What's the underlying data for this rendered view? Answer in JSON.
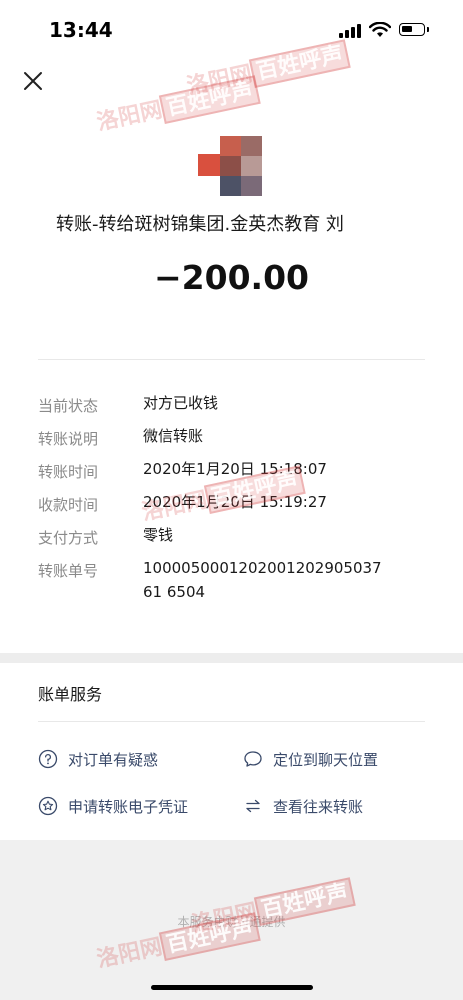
{
  "status_bar": {
    "time": "13:44"
  },
  "header": {
    "close_icon": "close-icon"
  },
  "payment": {
    "payee": "转账-转给斑树锦集团.金英杰教育 刘",
    "amount": "−200.00"
  },
  "details": [
    {
      "label": "当前状态",
      "value": "对方已收钱"
    },
    {
      "label": "转账说明",
      "value": "微信转账"
    },
    {
      "label": "转账时间",
      "value": "2020年1月20日 15:18:07"
    },
    {
      "label": "收款时间",
      "value": "2020年1月20日 15:19:27"
    },
    {
      "label": "支付方式",
      "value": "零钱"
    },
    {
      "label": "转账单号",
      "value": "100005000120200120290503761 6504"
    }
  ],
  "services": {
    "title": "账单服务",
    "items": [
      {
        "label": "对订单有疑惑",
        "icon": "question-icon"
      },
      {
        "label": "定位到聊天位置",
        "icon": "chat-bubble-icon"
      },
      {
        "label": "申请转账电子凭证",
        "icon": "star-badge-icon"
      },
      {
        "label": "查看往来转账",
        "icon": "transfer-arrows-icon"
      }
    ]
  },
  "footer": {
    "note": "本服务由财付通提供"
  },
  "watermarks": {
    "brand_a": "洛阳网",
    "brand_b": "百姓呼声"
  },
  "colors": {
    "link_text": "#3a4a6a",
    "label_gray": "#8a8a8a"
  }
}
